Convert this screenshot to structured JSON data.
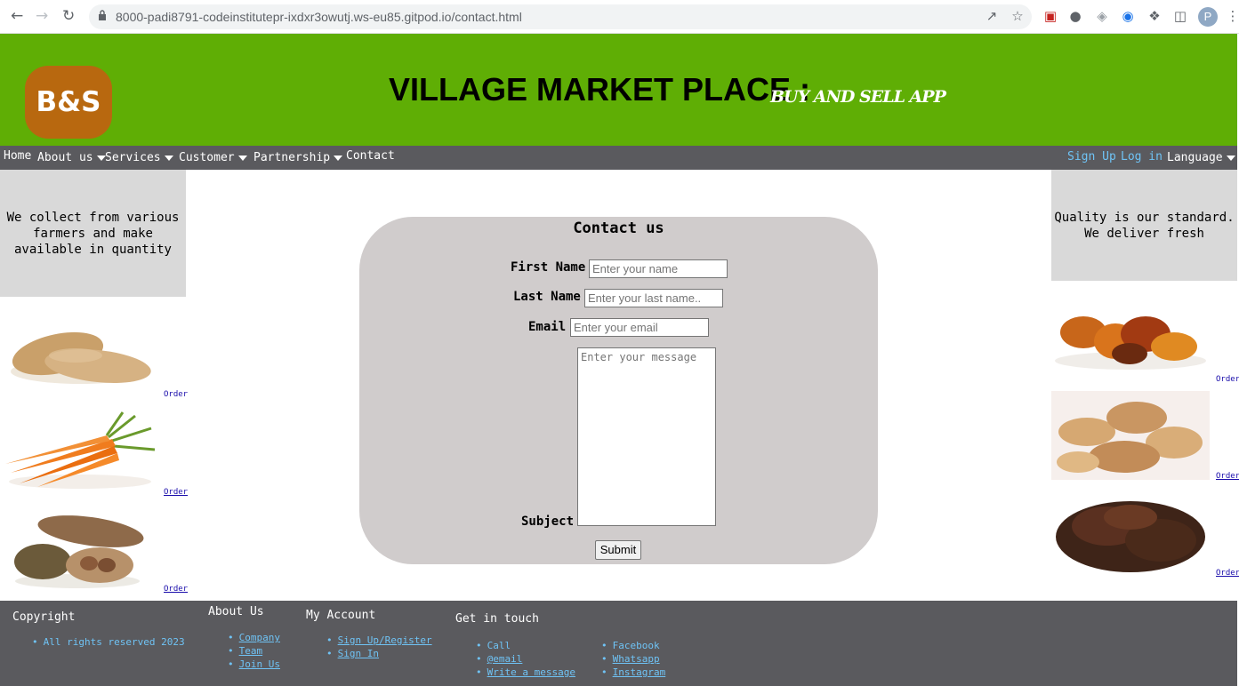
{
  "browser": {
    "url": "8000-padi8791-codeinstitutepr-ixdxr3owutj.ws-eu85.gitpod.io/contact.html",
    "profile_initial": "P"
  },
  "header": {
    "logo_text": "B&S",
    "title": "VILLAGE MARKET PLACE :",
    "subtitle": "BUY AND SELL APP",
    "bg_color": "#5fae05"
  },
  "navbar": {
    "home": "Home",
    "about": "About us",
    "services": "Services",
    "customer": "Customer",
    "partnership": "Partnership",
    "contact": "Contact",
    "signup": "Sign Up",
    "login": "Log in",
    "language": "Language"
  },
  "left": {
    "blurb": "We collect from various farmers and make available in quantity",
    "products": [
      {
        "name": "sweet-potatoes",
        "order": "Order"
      },
      {
        "name": "carrots",
        "order": "Order"
      },
      {
        "name": "cocoa-pods",
        "order": "Order"
      }
    ]
  },
  "right": {
    "blurb": "Quality is our standard. We deliver fresh",
    "products": [
      {
        "name": "palm-fruits",
        "order": "Order"
      },
      {
        "name": "groundnuts",
        "order": "Order"
      },
      {
        "name": "coffee-beans",
        "order": "Order"
      }
    ]
  },
  "contact": {
    "heading": "Contact us",
    "first_name_label": "First Name",
    "first_name_placeholder": "Enter your name",
    "last_name_label": "Last Name",
    "last_name_placeholder": "Enter your last name..",
    "email_label": "Email",
    "email_placeholder": "Enter your email",
    "subject_label": "Subject",
    "message_placeholder": "Enter your message",
    "submit": "Submit"
  },
  "footer": {
    "copyright_title": "Copyright",
    "copyright_text": "All rights reserved 2023",
    "about_title": "About Us",
    "about_links": [
      "Company",
      "Team",
      "Join Us"
    ],
    "account_title": "My Account",
    "account_links": [
      "Sign Up/Register",
      "Sign In"
    ],
    "touch_title": "Get in touch",
    "touch_left": [
      "Call",
      "@email",
      "Write a message"
    ],
    "touch_right": [
      "Facebook",
      "Whatsapp",
      "Instagram"
    ]
  }
}
